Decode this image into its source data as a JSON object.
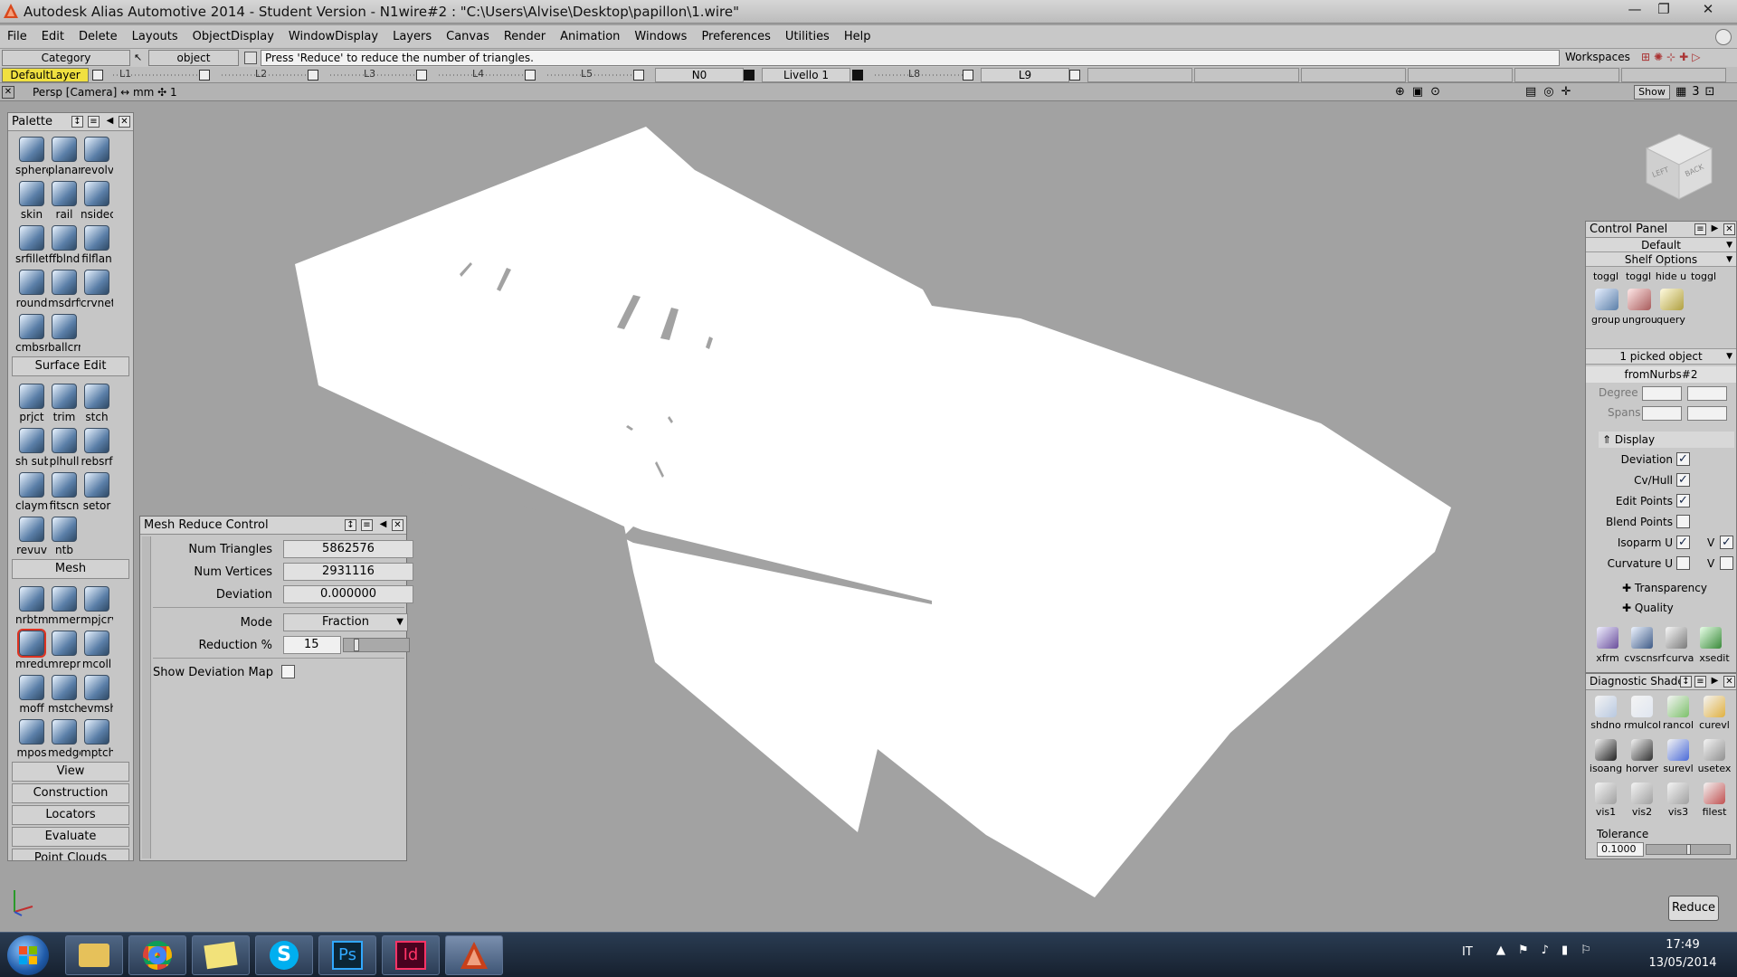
{
  "window": {
    "title": "Autodesk Alias Automotive 2014   - Student Version   - N1wire#2 : \"C:\\Users\\Alvise\\Desktop\\papillon\\1.wire\"",
    "minimize": "—",
    "maximize": "❐",
    "close": "✕"
  },
  "menu": [
    "File",
    "Edit",
    "Delete",
    "Layouts",
    "ObjectDisplay",
    "WindowDisplay",
    "Layers",
    "Canvas",
    "Render",
    "Animation",
    "Windows",
    "Preferences",
    "Utilities",
    "Help"
  ],
  "prompt": {
    "category_label": "Category",
    "object_label": "object",
    "message": "Press 'Reduce' to reduce the number of triangles.",
    "workspaces": "Workspaces"
  },
  "layers": {
    "default": "DefaultLayer",
    "items": [
      "L1",
      "L2",
      "L3",
      "L4",
      "L5",
      "N0",
      "Livello 1",
      "L8",
      "L9"
    ]
  },
  "view": {
    "label": "Persp [Camera]  ↔ mm   ✣ 1",
    "show": "Show",
    "viewcube_left": "LEFT",
    "viewcube_back": "BACK"
  },
  "palette": {
    "title": "Palette",
    "groups": [
      {
        "tools": [
          "sphere",
          "planar",
          "revolv",
          "skin",
          "rail",
          "nsided",
          "srfillet",
          "ffblnd",
          "filflan",
          "round",
          "msdrft",
          "crvnet",
          "cmbsrf",
          "ballcrn"
        ]
      },
      {
        "section": "Surface Edit",
        "tools": [
          "prjct",
          "trim",
          "stch",
          "sh sub",
          "plhull",
          "rebsrf",
          "claymt",
          "fitscn",
          "setor",
          "revuv",
          "ntb"
        ]
      },
      {
        "section": "Mesh",
        "tools": [
          "nrbtm",
          "mmerg",
          "mpjcrv",
          "mredu",
          "mrepr",
          "mcoll",
          "moff",
          "mstch",
          "evmsh",
          "mpos",
          "medge",
          "mptch"
        ]
      }
    ],
    "sections": [
      "View",
      "Construction",
      "Locators",
      "Evaluate",
      "Point Clouds"
    ]
  },
  "mesh_reduce": {
    "title": "Mesh Reduce Control",
    "num_triangles_label": "Num Triangles",
    "num_triangles": "5862576",
    "num_vertices_label": "Num Vertices",
    "num_vertices": "2931116",
    "deviation_label": "Deviation",
    "deviation": "0.000000",
    "mode_label": "Mode",
    "mode": "Fraction",
    "reduction_label": "Reduction %",
    "reduction": "15",
    "reduction_fraction": 0.15,
    "show_deviation_label": "Show Deviation Map",
    "show_deviation": false
  },
  "control_panel": {
    "title": "Control Panel",
    "preset": "Default",
    "shelf": "Shelf Options",
    "shelf_tools": [
      "toggl",
      "toggl",
      "hide u",
      "toggl",
      "group",
      "ungrou",
      "query"
    ],
    "picked": "1 picked object",
    "object_name": "fromNurbs#2",
    "degree_label": "Degree",
    "spans_label": "Spans",
    "display_label": "Display",
    "display": [
      {
        "label": "Deviation",
        "checked": true
      },
      {
        "label": "Cv/Hull",
        "checked": true
      },
      {
        "label": "Edit Points",
        "checked": true
      },
      {
        "label": "Blend Points",
        "checked": false
      },
      {
        "label": "Isoparm U",
        "checked": true,
        "v": true
      },
      {
        "label": "Curvature U",
        "checked": false,
        "v": false
      }
    ],
    "v_label": "V",
    "transparency": "Transparency",
    "quality": "Quality",
    "bottom_tools": [
      "xfrm",
      "cvscnsrf",
      "curva",
      "xsedit"
    ]
  },
  "diagnostic": {
    "title": "Diagnostic Shade",
    "tools": [
      "shdno",
      "rmulcol",
      "rancol",
      "curevl",
      "isoang",
      "horver",
      "surevl",
      "usetex",
      "vis1",
      "vis2",
      "vis3",
      "filest"
    ],
    "tolerance_label": "Tolerance",
    "tolerance": "0.1000"
  },
  "reduce_button": "Reduce",
  "taskbar": {
    "apps": [
      "chrome",
      "explorer",
      "skype",
      "photoshop",
      "indesign",
      "alias"
    ],
    "lang": "IT",
    "time": "17:49",
    "date": "13/05/2014"
  },
  "colors": {
    "viewport": "#a2a2a2",
    "mesh": "#ffffff",
    "panel": "#c7c7c7",
    "taskbar": "#1f2c3d"
  }
}
